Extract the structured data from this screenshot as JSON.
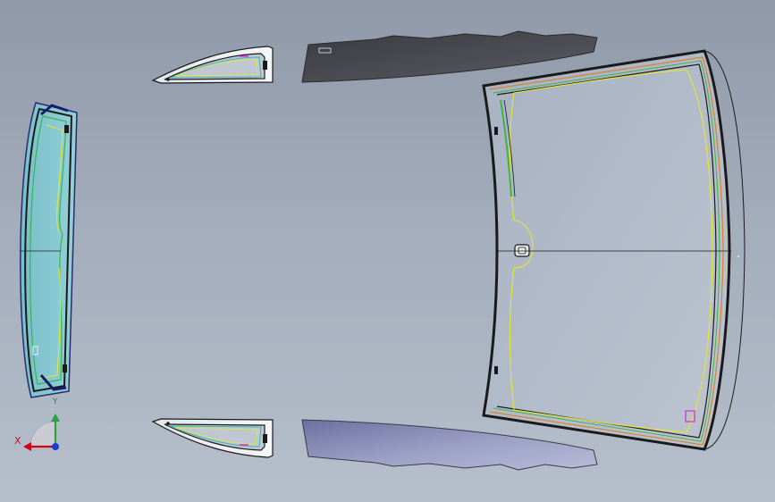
{
  "viewport": {
    "background_top": "#8f99a9",
    "background_bottom": "#b6bfcb"
  },
  "triad": {
    "x_label": "X",
    "y_label": "Y",
    "x_color": "#d0021b",
    "y_color": "#2ea043",
    "z_color": "#1f3fd1"
  },
  "parts": {
    "rear_window": "rear-window-glass",
    "windshield": "windshield-glass",
    "side_window_upper": "quarter-window-upper",
    "side_window_lower": "quarter-window-lower",
    "roof_panel_upper": "roof-strip-upper",
    "roof_panel_lower": "roof-strip-lower"
  },
  "colors": {
    "glass_tint": "#8ccbd3",
    "windshield_fill": "#b3bccb",
    "edge_dark": "#1a1a1a",
    "edge_green": "#3cb44a",
    "edge_yellow": "#e6e630",
    "edge_orange": "#d9822b",
    "marker_magenta": "#d62ad6",
    "strip_dark": "#4a4c52",
    "strip_light": "#8b8fb4"
  }
}
